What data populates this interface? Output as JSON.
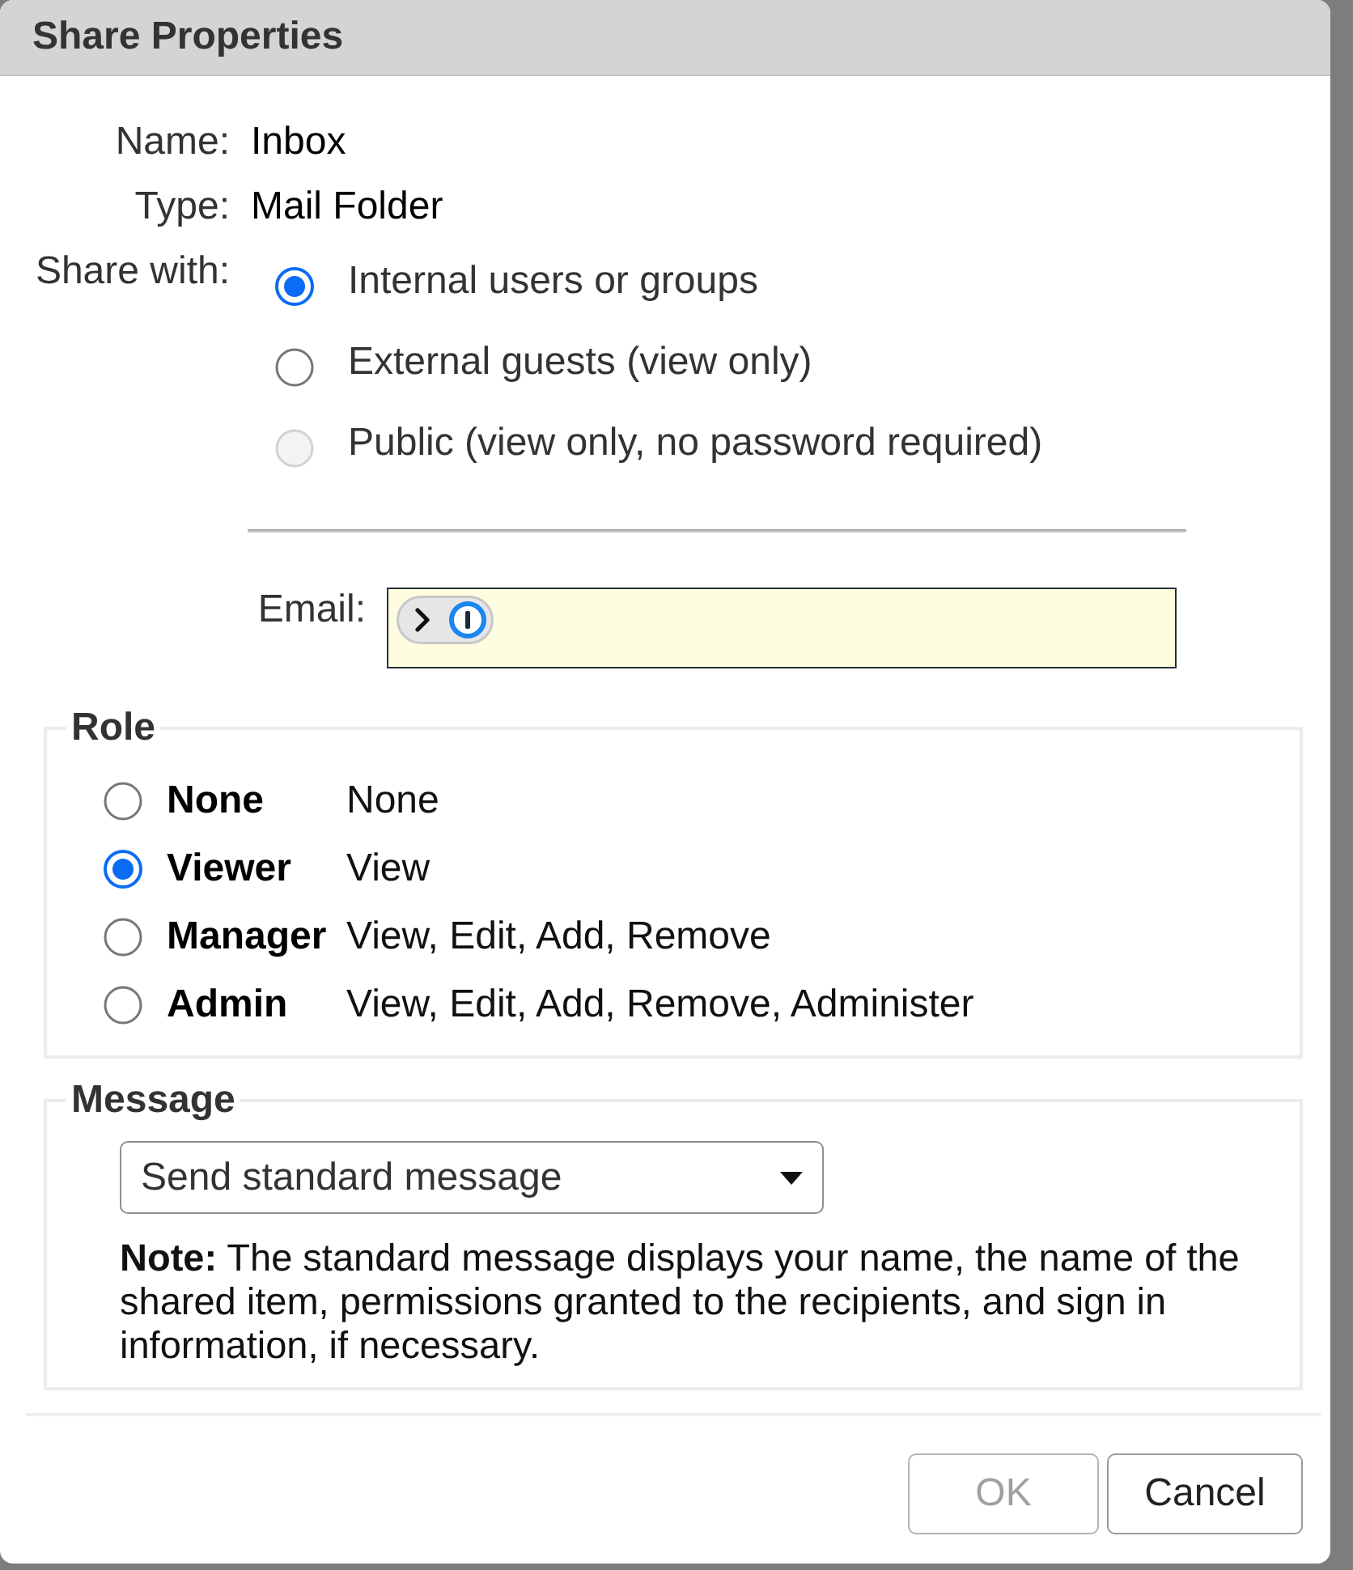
{
  "dialog": {
    "title": "Share Properties"
  },
  "details": [
    {
      "label": "Name:",
      "value": "Inbox"
    },
    {
      "label": "Type:",
      "value": "Mail Folder"
    }
  ],
  "share_with": {
    "label": "Share with:",
    "options": [
      {
        "label": "Internal users or groups",
        "selected": true,
        "disabled": false
      },
      {
        "label": "External guests (view only)",
        "selected": false,
        "disabled": false
      },
      {
        "label": "Public (view only, no password required)",
        "selected": false,
        "disabled": true
      }
    ]
  },
  "email": {
    "label": "Email:"
  },
  "role": {
    "legend": "Role",
    "options": [
      {
        "name": "None",
        "permissions": "None",
        "selected": false
      },
      {
        "name": "Viewer",
        "permissions": "View",
        "selected": true
      },
      {
        "name": "Manager",
        "permissions": "View, Edit, Add, Remove",
        "selected": false
      },
      {
        "name": "Admin",
        "permissions": "View, Edit, Add, Remove, Administer",
        "selected": false
      }
    ]
  },
  "message": {
    "legend": "Message",
    "select": {
      "value": "Send standard message"
    },
    "note": "**Note:** The standard message displays your name, the name of the shared item, permissions granted to the recipients, and sign in information, if necessary."
  },
  "buttons": [
    {
      "label": "OK",
      "disabled": true
    },
    {
      "label": "Cancel",
      "disabled": false
    }
  ]
}
